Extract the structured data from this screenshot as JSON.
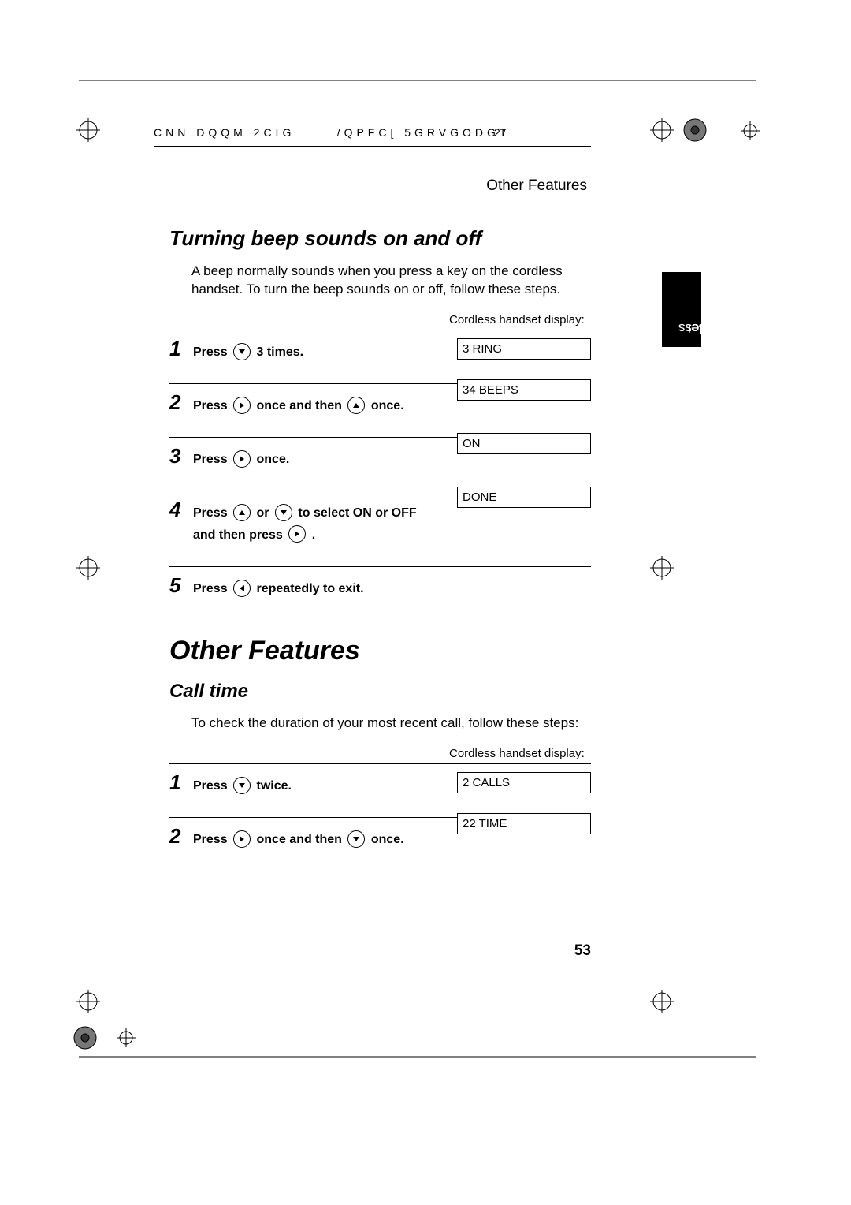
{
  "header": {
    "code_left": "CNN  DQQM   2CIG",
    "code_mid": "/QPFC[   5GRVGODGT",
    "code_right": "2/",
    "breadcrumb": "Other Features"
  },
  "side_tab": {
    "line1": "2. Cordless",
    "line2": "Handset"
  },
  "section1": {
    "title": "Turning beep sounds on and off",
    "intro": "A beep normally sounds when you press a key on the cordless handset. To turn the beep sounds on or off, follow these steps.",
    "display_label": "Cordless handset display:",
    "steps": [
      {
        "num": "1",
        "pre": "Press ",
        "post": " 3 times.",
        "icons": [
          "down"
        ],
        "display": "3  RING"
      },
      {
        "num": "2",
        "pre": "Press ",
        "mid": " once and then ",
        "post": " once.",
        "icons": [
          "right",
          "up"
        ],
        "display": "34 BEEPS"
      },
      {
        "num": "3",
        "pre": "Press ",
        "post": " once.",
        "icons": [
          "right"
        ],
        "display": "ON"
      },
      {
        "num": "4",
        "pre": "Press ",
        "mid": " or ",
        "post": " to select ON or OFF",
        "line2_pre": "and then press ",
        "line2_post": " .",
        "icons": [
          "up",
          "down",
          "right"
        ],
        "display": "DONE"
      },
      {
        "num": "5",
        "pre": "Press ",
        "post": " repeatedly to exit.",
        "icons": [
          "left"
        ],
        "display": null
      }
    ]
  },
  "big_title": "Other Features",
  "section2": {
    "title": "Call time",
    "intro": "To check the duration of your most recent call, follow these steps:",
    "display_label": "Cordless handset display:",
    "steps": [
      {
        "num": "1",
        "pre": "Press ",
        "post": " twice.",
        "icons": [
          "down"
        ],
        "display": "2  CALLS"
      },
      {
        "num": "2",
        "pre": "Press ",
        "mid": " once and then ",
        "post": " once.",
        "icons": [
          "right",
          "down"
        ],
        "display": "22 TIME"
      }
    ]
  },
  "page_number": "53"
}
